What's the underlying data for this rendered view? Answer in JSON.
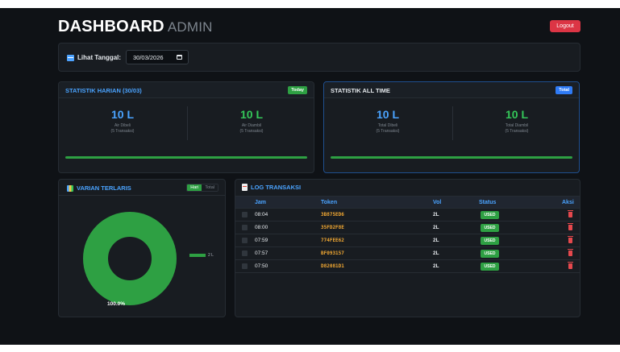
{
  "header": {
    "title": "DASHBOARD",
    "subtitle": "ADMIN",
    "logout_label": "Logout"
  },
  "date_filter": {
    "label": "Lihat Tanggal:",
    "value": "30/03/2026"
  },
  "daily_stats": {
    "title": "STATISTIK HARIAN (30/03)",
    "badge": "Today",
    "left": {
      "value": "10 L",
      "label": "Air Dibeli",
      "sub": "(5 Transaksi)"
    },
    "right": {
      "value": "10 L",
      "label": "Air Diambil",
      "sub": "(5 Transaksi)"
    },
    "progress": 1.0
  },
  "all_time_stats": {
    "title": "STATISTIK ALL TIME",
    "badge": "Total",
    "left": {
      "value": "10 L",
      "label": "Total Dibeli",
      "sub": "(5 Transaksi)"
    },
    "right": {
      "value": "10 L",
      "label": "Total Diambil",
      "sub": "(5 Transaksi)"
    },
    "progress": 1.0
  },
  "varian": {
    "title": "VARIAN TERLARIS",
    "toggle": {
      "active": "Hari",
      "inactive": "Total"
    },
    "legend_label": "2 L",
    "percent_label": "100.0%",
    "color": "#2ea043"
  },
  "chart_data": {
    "type": "pie",
    "categories": [
      "2 L"
    ],
    "values": [
      100.0
    ]
  },
  "log": {
    "title": "LOG TRANSAKSI",
    "columns": [
      "Jam",
      "Token",
      "Vol",
      "Status",
      "Aksi"
    ],
    "rows": [
      {
        "jam": "08:04",
        "token": "3B875ED6",
        "vol": "2L",
        "status": "USED"
      },
      {
        "jam": "08:00",
        "token": "35FD2F8E",
        "vol": "2L",
        "status": "USED"
      },
      {
        "jam": "07:59",
        "token": "774FEE62",
        "vol": "2L",
        "status": "USED"
      },
      {
        "jam": "07:57",
        "token": "BF093157",
        "vol": "2L",
        "status": "USED"
      },
      {
        "jam": "07:50",
        "token": "D82081D1",
        "vol": "2L",
        "status": "USED"
      }
    ]
  }
}
